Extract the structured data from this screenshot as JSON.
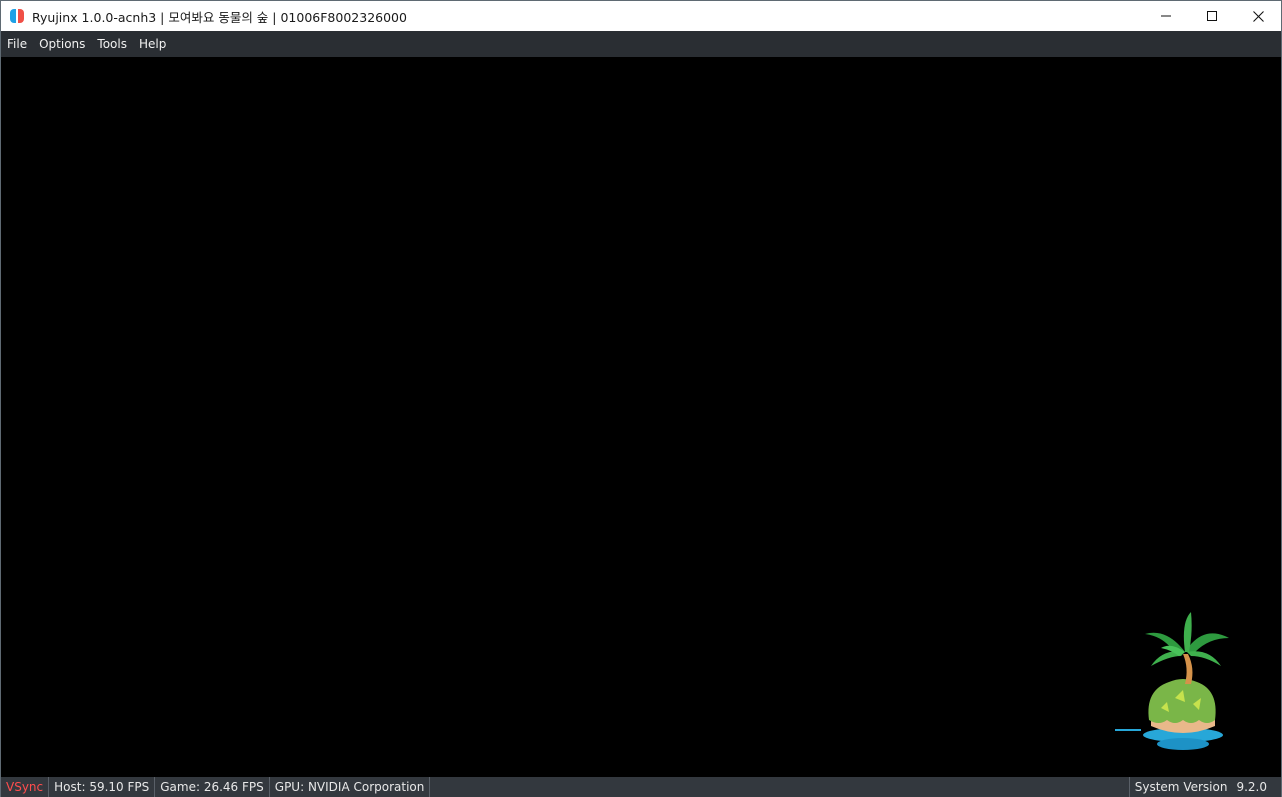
{
  "window": {
    "title": "Ryujinx 1.0.0-acnh3 | 모여봐요 동물의 숲 | 01006F8002326000",
    "icon": "ryujinx-logo-icon",
    "controls": [
      "minimize-icon",
      "maximize-icon",
      "close-icon"
    ]
  },
  "menu": {
    "items": [
      "File",
      "Options",
      "Tools",
      "Help"
    ]
  },
  "viewport": {
    "icon": "island-palm-tree-icon"
  },
  "status": {
    "vsync": "VSync",
    "host": "Host: 59.10 FPS",
    "game": "Game: 26.46 FPS",
    "gpu": "GPU: NVIDIA Corporation",
    "system_version_label": "System Version",
    "system_version": "9.2.0"
  },
  "colors": {
    "vsync_off": "#ff4d4d",
    "menubar": "#2a2e33",
    "statusbar": "#33383e"
  }
}
